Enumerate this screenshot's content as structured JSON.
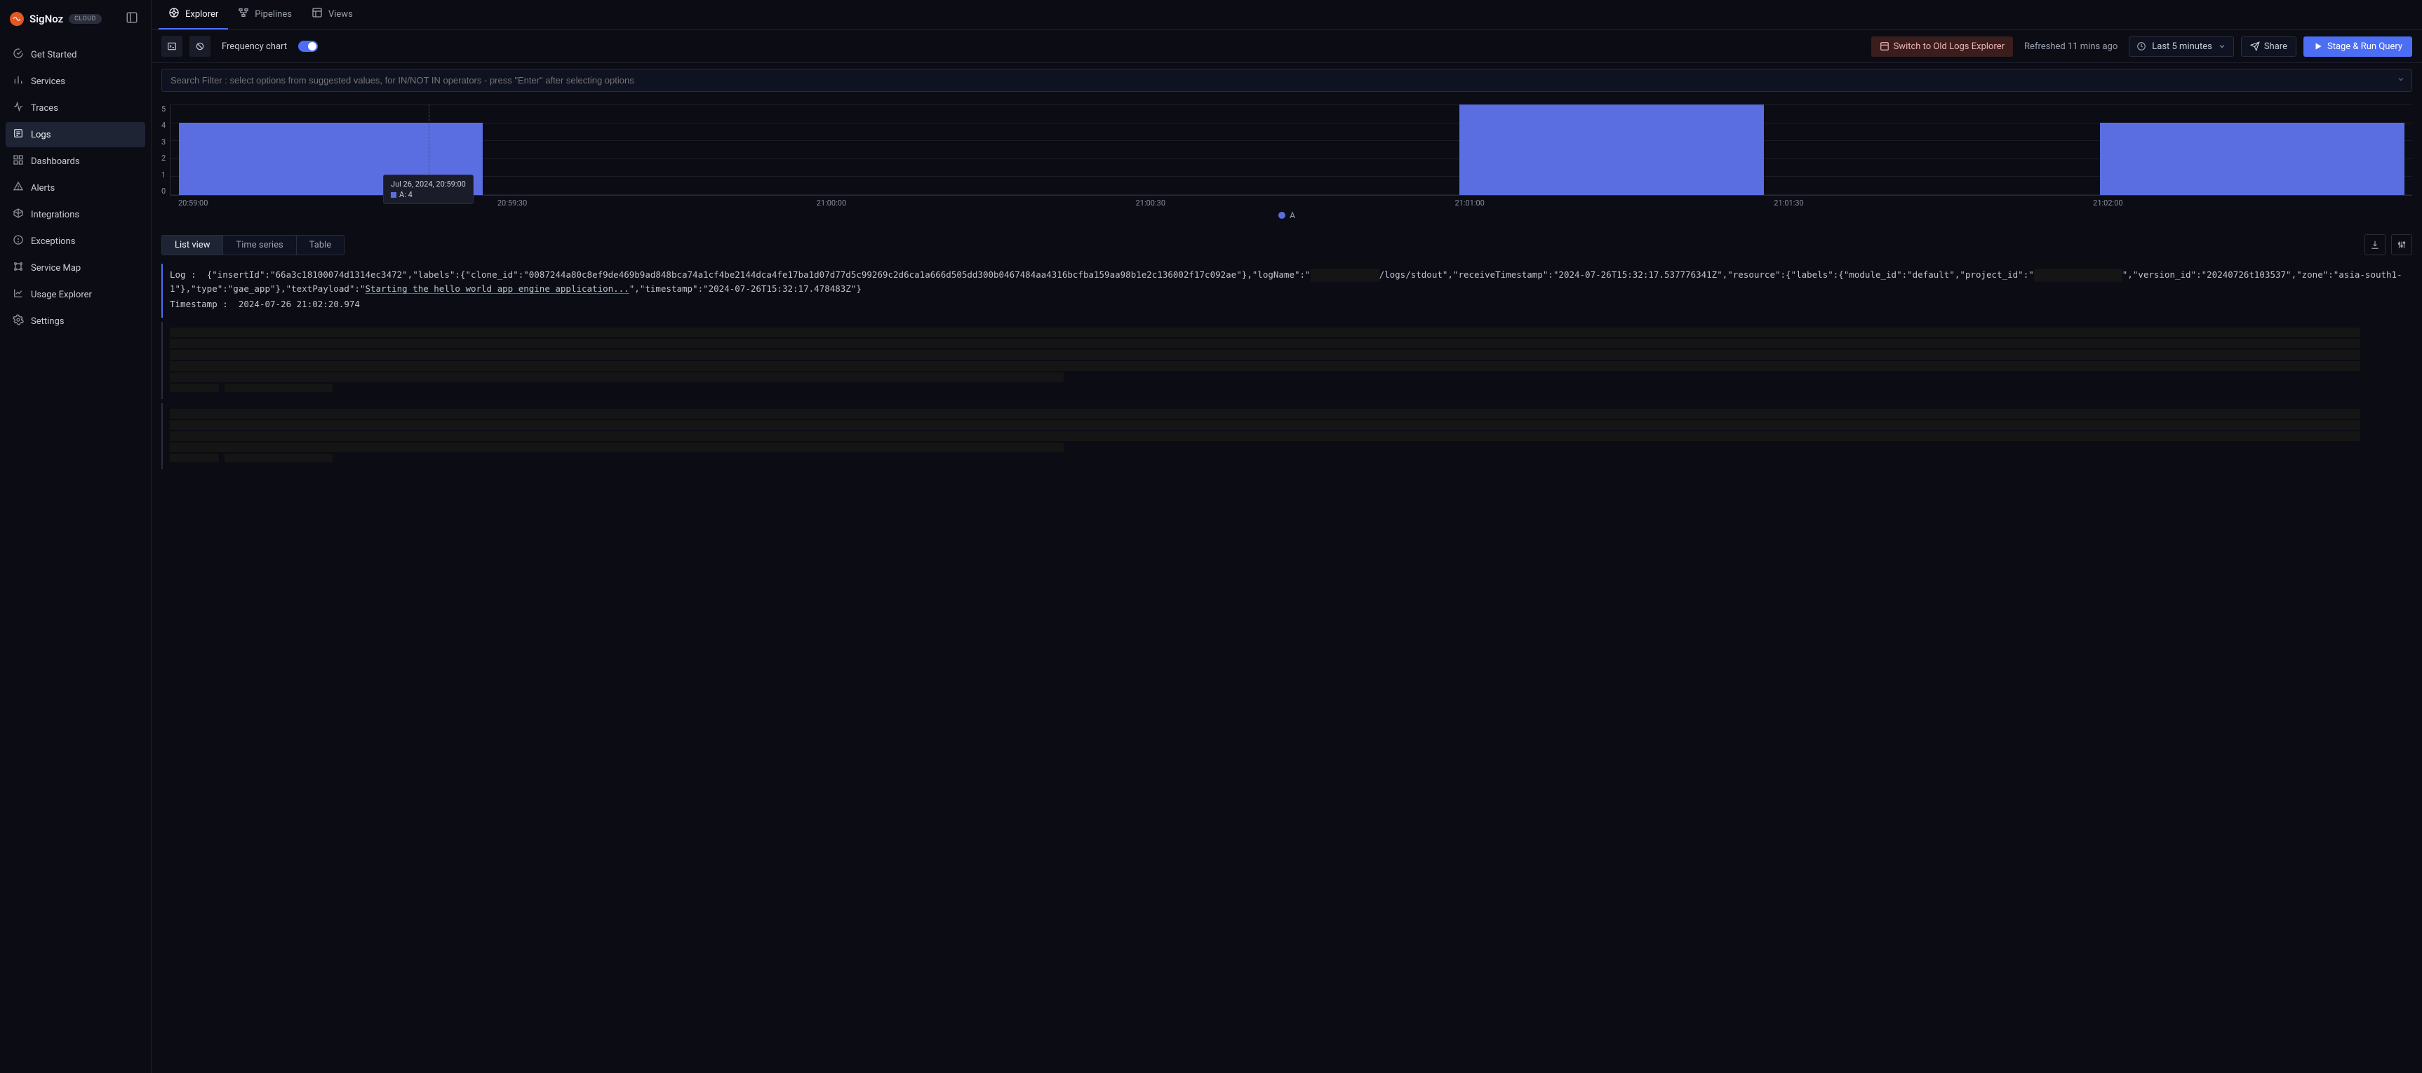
{
  "brand": {
    "name": "SigNoz",
    "badge": "CLOUD"
  },
  "sidebar": {
    "items": [
      {
        "label": "Get Started"
      },
      {
        "label": "Services"
      },
      {
        "label": "Traces"
      },
      {
        "label": "Logs"
      },
      {
        "label": "Dashboards"
      },
      {
        "label": "Alerts"
      },
      {
        "label": "Integrations"
      },
      {
        "label": "Exceptions"
      },
      {
        "label": "Service Map"
      },
      {
        "label": "Usage Explorer"
      },
      {
        "label": "Settings"
      }
    ],
    "active_index": 3
  },
  "top_tabs": {
    "items": [
      {
        "label": "Explorer"
      },
      {
        "label": "Pipelines"
      },
      {
        "label": "Views"
      }
    ],
    "active_index": 0
  },
  "toolbar": {
    "frequency_label": "Frequency chart",
    "frequency_on": true,
    "switch_label": "Switch to Old Logs Explorer",
    "refreshed_label": "Refreshed 11 mins ago",
    "time_range_label": "Last 5 minutes",
    "share_label": "Share",
    "run_label": "Stage & Run Query"
  },
  "filter": {
    "placeholder": "Search Filter : select options from suggested values, for IN/NOT IN operators - press \"Enter\" after selecting options"
  },
  "chart_data": {
    "type": "bar",
    "y_ticks": [
      "5",
      "4",
      "3",
      "2",
      "1",
      "0"
    ],
    "x_ticks": [
      "20:59:00",
      "20:59:30",
      "21:00:00",
      "21:00:30",
      "21:01:00",
      "21:01:30",
      "21:02:00"
    ],
    "series_name": "A",
    "values": [
      4,
      0,
      0,
      0,
      5,
      0,
      4
    ],
    "ymax": 5,
    "tooltip": {
      "time": "Jul 26, 2024, 20:59:00",
      "series": "A",
      "value": "4"
    },
    "legend": "A"
  },
  "view_modes": {
    "items": [
      "List view",
      "Time series",
      "Table"
    ],
    "active_index": 0
  },
  "logs": [
    {
      "label": "Log :",
      "body_pre": "{\"insertId\":\"66a3c18100074d1314ec3472\",\"labels\":{\"clone_id\":\"0087244a80c8ef9de469b9ad848bca74a1cf4be2144dca4fe17ba1d07d77d5c99269c2d6ca1a666d505dd300b0467484aa4316bcfba159aa98b1e2c136002f17c092ae\"},\"logName\":\"",
      "redact1_len": 14,
      "body_mid1": "/logs/stdout\",\"receiveTimestamp\":\"2024-07-26T15:32:17.537776341Z\",\"resource\":{\"labels\":{\"module_id\":\"default\",\"project_id\":\"",
      "redact2_len": 18,
      "body_mid2": "\",\"version_id\":\"20240726t103537\",\"zone\":\"asia-south1-1\"},\"type\":\"gae_app\"},\"textPayload\":\"",
      "body_highlight": "Starting the hello world app engine application...",
      "body_post": "\",\"timestamp\":\"2024-07-26T15:32:17.478483Z\"}",
      "ts_label": "Timestamp :",
      "ts_value": "2024-07-26 21:02:20.974"
    }
  ],
  "redacted_entries": [
    {
      "lines": 5,
      "ts_redact_len": 22
    },
    {
      "lines": 4,
      "ts_redact_len": 22
    }
  ]
}
